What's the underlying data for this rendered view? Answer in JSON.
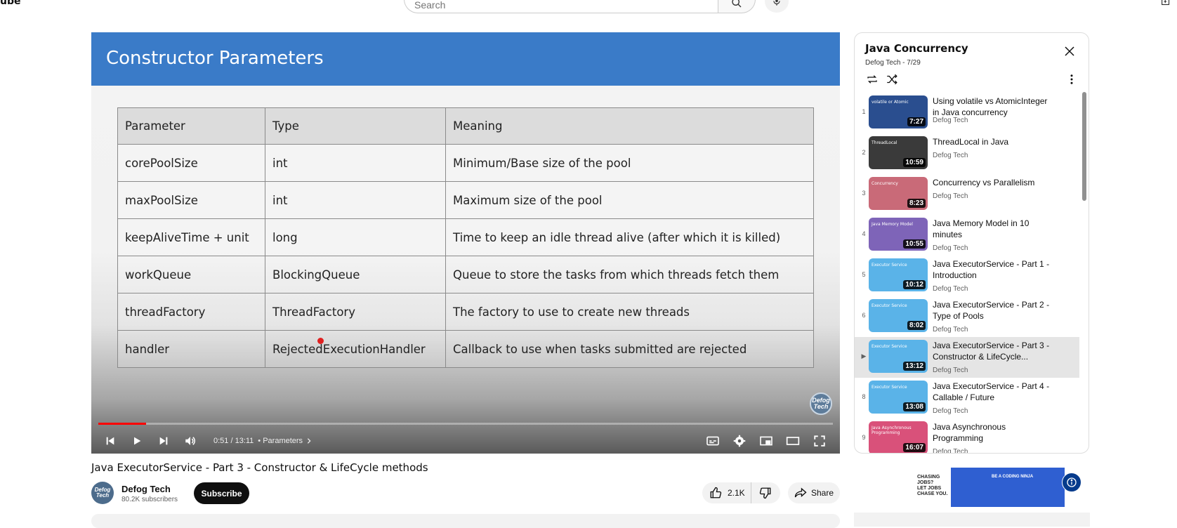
{
  "topbar": {
    "logo_fragment": "ube",
    "search_placeholder": "Search"
  },
  "player": {
    "slide_title": "Constructor Parameters",
    "table": {
      "headers": [
        "Parameter",
        "Type",
        "Meaning"
      ],
      "rows": [
        [
          "corePoolSize",
          "int",
          "Minimum/Base size of the pool"
        ],
        [
          "maxPoolSize",
          "int",
          "Maximum size of the pool"
        ],
        [
          "keepAliveTime + unit",
          "long",
          "Time to keep an idle thread alive (after which it is killed)"
        ],
        [
          "workQueue",
          "BlockingQueue",
          "Queue to store the tasks from which threads fetch them"
        ],
        [
          "threadFactory",
          "ThreadFactory",
          "The factory to use to create new threads"
        ],
        [
          "handler",
          "RejectedExecutionHandler",
          "Callback to use when tasks submitted are rejected"
        ]
      ]
    },
    "watermark": "Defog Tech",
    "time": "0:51 / 13:11",
    "chapter": "• Parameters",
    "progress": 0.065
  },
  "video": {
    "title": "Java ExecutorService - Part 3 - Constructor & LifeCycle methods",
    "channel": "Defog Tech",
    "subscribers": "80.2K subscribers",
    "subscribe_label": "Subscribe",
    "likes": "2.1K",
    "share_label": "Share"
  },
  "playlist": {
    "title": "Java Concurrency",
    "meta": "Defog Tech - 7/29",
    "items": [
      {
        "index": "1",
        "title": "Using volatile vs AtomicInteger in Java concurrency",
        "channel": "Defog Tech",
        "duration": "7:27",
        "thumb_label": "volatile or Atomic",
        "thumb_color": "#2a4e8f"
      },
      {
        "index": "2",
        "title": "ThreadLocal in Java",
        "channel": "Defog Tech",
        "duration": "10:59",
        "thumb_label": "ThreadLocal",
        "thumb_color": "#3a3a3a"
      },
      {
        "index": "3",
        "title": "Concurrency vs Parallelism",
        "channel": "Defog Tech",
        "duration": "8:23",
        "thumb_label": "Concurrency",
        "thumb_color": "#c96a78"
      },
      {
        "index": "4",
        "title": "Java Memory Model in 10 minutes",
        "channel": "Defog Tech",
        "duration": "10:55",
        "thumb_label": "Java Memory Model",
        "thumb_color": "#7e64b8"
      },
      {
        "index": "5",
        "title": "Java ExecutorService - Part 1 - Introduction",
        "channel": "Defog Tech",
        "duration": "10:12",
        "thumb_label": "Executor Service",
        "thumb_color": "#5ab3e8"
      },
      {
        "index": "6",
        "title": "Java ExecutorService - Part 2 - Type of Pools",
        "channel": "Defog Tech",
        "duration": "8:02",
        "thumb_label": "Executor Service",
        "thumb_color": "#5ab3e8"
      },
      {
        "index": "▶",
        "title": "Java ExecutorService - Part 3 - Constructor & LifeCycle...",
        "channel": "Defog Tech",
        "duration": "13:12",
        "thumb_label": "Executor Service",
        "thumb_color": "#5ab3e8"
      },
      {
        "index": "8",
        "title": "Java ExecutorService - Part 4 - Callable / Future",
        "channel": "Defog Tech",
        "duration": "13:08",
        "thumb_label": "Executor Service",
        "thumb_color": "#5ab3e8"
      },
      {
        "index": "9",
        "title": "Java Asynchronous Programming",
        "channel": "Defog Tech",
        "duration": "16:07",
        "thumb_label": "Java Asynchronous Programming",
        "thumb_color": "#d9517a"
      }
    ]
  },
  "ad": {
    "text_lines": [
      "CHASING",
      "JOBS?",
      "LET JOBS",
      "CHASE YOU."
    ],
    "banner_text": "BE A CODING NINJA"
  }
}
